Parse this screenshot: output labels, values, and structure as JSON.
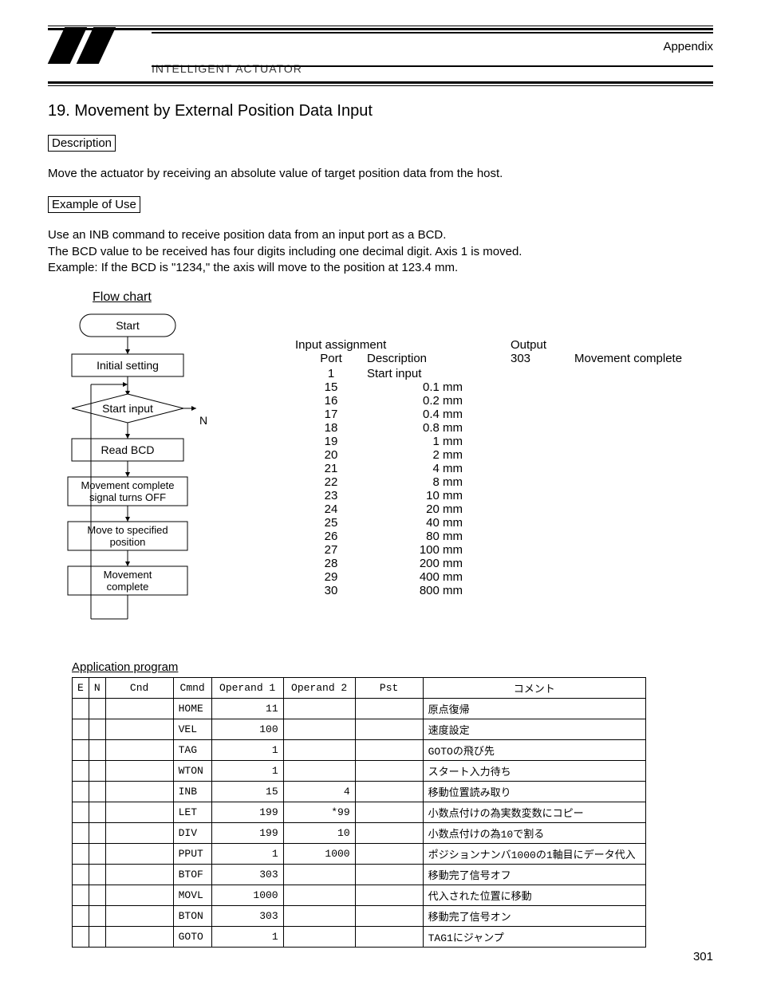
{
  "header": {
    "brand": "INTELLIGENT ACTUATOR",
    "appendix": "Appendix"
  },
  "title": "19. Movement by External Position Data Input",
  "desc_label": "Description",
  "desc_text": "Move the actuator by receiving an absolute value of target position data from the host.",
  "example_label": "Example of Use",
  "example_lines": [
    "Use an INB command to receive position data from an input port as a BCD.",
    "The BCD value to be received has four digits including one decimal digit. Axis 1 is moved.",
    "Example: If the BCD is \"1234,\" the axis will move to the position at 123.4 mm."
  ],
  "flow_title": "Flow chart",
  "flow_nodes": {
    "start": "Start",
    "init": "Initial setting",
    "decision": "Start input",
    "n_label": "N",
    "read": "Read BCD",
    "off1": "Movement complete",
    "off2": "signal turns OFF",
    "move1": "Move to specified",
    "move2": "position",
    "done1": "Movement",
    "done2": "complete"
  },
  "io": {
    "input_hd": "Input assignment",
    "port_hd": "Port",
    "desc_hd": "Description",
    "output_hd": "Output",
    "out_port": "303",
    "out_desc": "Movement complete",
    "rows": [
      {
        "port": "1",
        "desc": "Start input"
      },
      {
        "port": "15",
        "desc": "0.1 mm"
      },
      {
        "port": "16",
        "desc": "0.2 mm"
      },
      {
        "port": "17",
        "desc": "0.4 mm"
      },
      {
        "port": "18",
        "desc": "0.8 mm"
      },
      {
        "port": "19",
        "desc": "1 mm"
      },
      {
        "port": "20",
        "desc": "2 mm"
      },
      {
        "port": "21",
        "desc": "4 mm"
      },
      {
        "port": "22",
        "desc": "8 mm"
      },
      {
        "port": "23",
        "desc": "10 mm"
      },
      {
        "port": "24",
        "desc": "20 mm"
      },
      {
        "port": "25",
        "desc": "40 mm"
      },
      {
        "port": "26",
        "desc": "80 mm"
      },
      {
        "port": "27",
        "desc": "100 mm"
      },
      {
        "port": "28",
        "desc": "200 mm"
      },
      {
        "port": "29",
        "desc": "400 mm"
      },
      {
        "port": "30",
        "desc": "800 mm"
      }
    ]
  },
  "app_title": "Application program",
  "table": {
    "headers": {
      "e": "E",
      "n": "N",
      "cnd": "Cnd",
      "cmnd": "Cmnd",
      "op1": "Operand 1",
      "op2": "Operand 2",
      "pst": "Pst",
      "com": "コメント"
    },
    "rows": [
      {
        "cmnd": "HOME",
        "op1": "11",
        "op2": "",
        "com": "原点復帰"
      },
      {
        "cmnd": "VEL",
        "op1": "100",
        "op2": "",
        "com": "速度設定"
      },
      {
        "cmnd": "TAG",
        "op1": "1",
        "op2": "",
        "com": "GOTOの飛び先"
      },
      {
        "cmnd": "WTON",
        "op1": "1",
        "op2": "",
        "com": "スタート入力待ち"
      },
      {
        "cmnd": "INB",
        "op1": "15",
        "op2": "4",
        "com": "移動位置読み取り"
      },
      {
        "cmnd": "LET",
        "op1": "199",
        "op2": "*99",
        "com": "小数点付けの為実数変数にコピー"
      },
      {
        "cmnd": "DIV",
        "op1": "199",
        "op2": "10",
        "com": "小数点付けの為10で割る"
      },
      {
        "cmnd": "PPUT",
        "op1": "1",
        "op2": "1000",
        "com": "ポジションナンバ1000の1軸目にデータ代入"
      },
      {
        "cmnd": "BTOF",
        "op1": "303",
        "op2": "",
        "com": "移動完了信号オフ"
      },
      {
        "cmnd": "MOVL",
        "op1": "1000",
        "op2": "",
        "com": "代入された位置に移動"
      },
      {
        "cmnd": "BTON",
        "op1": "303",
        "op2": "",
        "com": "移動完了信号オン"
      },
      {
        "cmnd": "GOTO",
        "op1": "1",
        "op2": "",
        "com": "TAG1にジャンプ"
      }
    ]
  },
  "page_number": "301"
}
